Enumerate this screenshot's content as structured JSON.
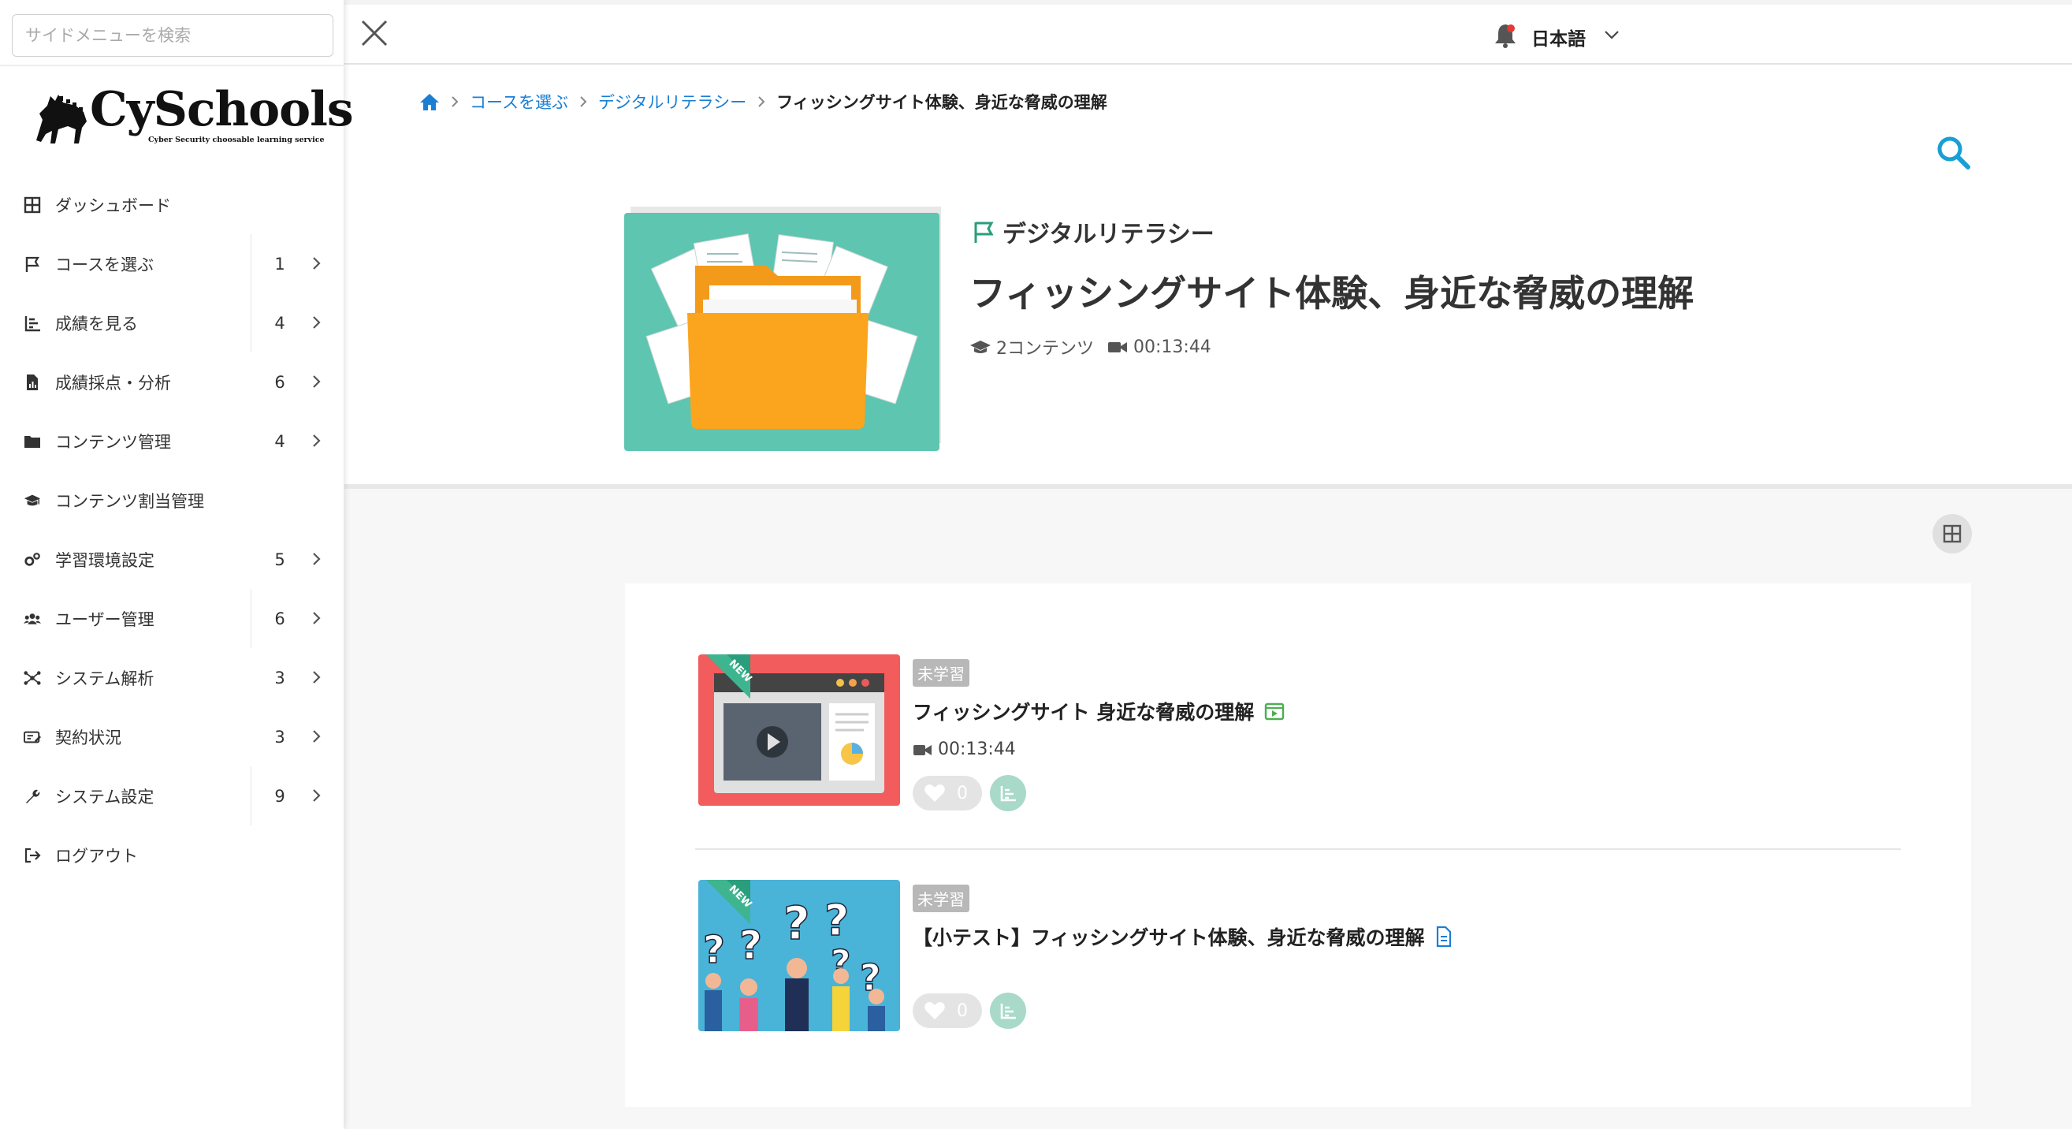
{
  "sidebar": {
    "search_placeholder": "サイドメニューを検索",
    "logo_text": "CySchools",
    "logo_tagline": "Cyber Security choosable learning service",
    "items": [
      {
        "label": "ダッシュボード",
        "count": "",
        "icon": "dashboard-icon",
        "has_chevron": false
      },
      {
        "label": "コースを選ぶ",
        "count": "1",
        "icon": "flag-icon",
        "has_chevron": true
      },
      {
        "label": "成績を見る",
        "count": "4",
        "icon": "bar-chart-icon",
        "has_chevron": true
      },
      {
        "label": "成績採点・分析",
        "count": "6",
        "icon": "document-chart-icon",
        "has_chevron": true
      },
      {
        "label": "コンテンツ管理",
        "count": "4",
        "icon": "folder-icon",
        "has_chevron": true
      },
      {
        "label": "コンテンツ割当管理",
        "count": "",
        "icon": "graduation-cap-icon",
        "has_chevron": false
      },
      {
        "label": "学習環境設定",
        "count": "5",
        "icon": "gears-icon",
        "has_chevron": true
      },
      {
        "label": "ユーザー管理",
        "count": "6",
        "icon": "users-icon",
        "has_chevron": true
      },
      {
        "label": "システム解析",
        "count": "3",
        "icon": "network-icon",
        "has_chevron": true
      },
      {
        "label": "契約状況",
        "count": "3",
        "icon": "contract-card-icon",
        "has_chevron": true
      },
      {
        "label": "システム設定",
        "count": "9",
        "icon": "wrench-icon",
        "has_chevron": true
      },
      {
        "label": "ログアウト",
        "count": "",
        "icon": "logout-icon",
        "has_chevron": false
      }
    ]
  },
  "topbar": {
    "language": "日本語"
  },
  "breadcrumb": {
    "items": [
      "コースを選ぶ",
      "デジタルリテラシー",
      "フィッシングサイト体験、身近な脅威の理解"
    ]
  },
  "course": {
    "category": "デジタルリテラシー",
    "title": "フィッシングサイト体験、身近な脅威の理解",
    "content_count": "2コンテンツ",
    "duration": "00:13:44"
  },
  "contents": [
    {
      "status": "未学習",
      "badge": "NEW",
      "title": "フィッシングサイト 身近な脅威の理解",
      "type_icon": "video-file-icon",
      "duration": "00:13:44",
      "likes": "0"
    },
    {
      "status": "未学習",
      "badge": "NEW",
      "title": "【小テスト】フィッシングサイト体験、身近な脅威の理解",
      "type_icon": "document-icon",
      "duration": "",
      "likes": "0"
    }
  ],
  "colors": {
    "accent": "#1a9fd4",
    "link": "#1a7fd4",
    "flag": "#2a9d7c",
    "stats_button": "#a9d9c9",
    "thumb1_bg": "#f25c5c",
    "thumb2_bg": "#4ab3d8",
    "course_thumb_bg": "#5dc5b0"
  }
}
